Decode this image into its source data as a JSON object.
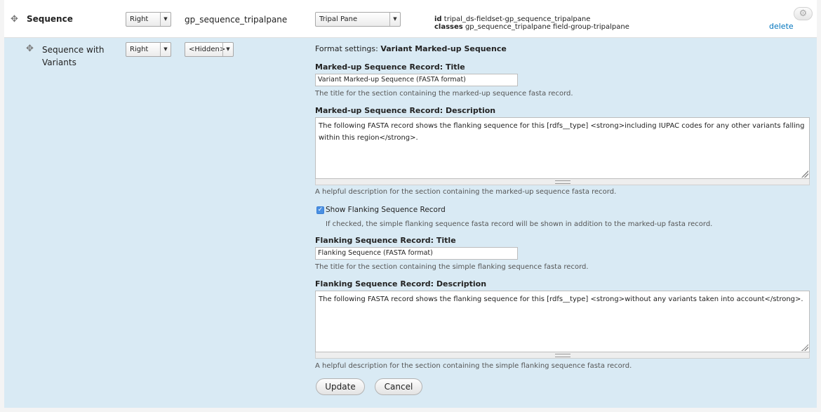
{
  "row_group": {
    "label": "Sequence",
    "region": "Right",
    "machine_name": "gp_sequence_tripalpane",
    "format": "Tripal Pane",
    "id_key": "id",
    "id_value": "tripal_ds-fieldset-gp_sequence_tripalpane",
    "classes_key": "classes",
    "classes_value": "gp_sequence_tripalpane field-group-tripalpane",
    "delete_label": "delete"
  },
  "row_field": {
    "label": "Sequence with Variants",
    "region": "Right",
    "label_display": "<Hidden>"
  },
  "format_settings": {
    "prefix": "Format settings:",
    "format_name": "Variant Marked-up Sequence",
    "markup_title_label": "Marked-up Sequence Record: Title",
    "markup_title_value": "Variant Marked-up Sequence (FASTA format)",
    "markup_title_help": "The title for the section containing the marked-up sequence fasta record.",
    "markup_desc_label": "Marked-up Sequence Record: Description",
    "markup_desc_value": "The following FASTA record shows the flanking sequence for this [rdfs__type] <strong>including IUPAC codes for any other variants falling within this region</strong>.",
    "markup_desc_help": "A helpful description for the section containing the marked-up sequence fasta record.",
    "show_flanking_label": "Show Flanking Sequence Record",
    "show_flanking_checked": true,
    "show_flanking_help": "If checked, the simple flanking sequence fasta record will be shown in addition to the marked-up fasta record.",
    "flank_title_label": "Flanking Sequence Record: Title",
    "flank_title_value": "Flanking Sequence (FASTA format)",
    "flank_title_help": "The title for the section containing the simple flanking sequence fasta record.",
    "flank_desc_label": "Flanking Sequence Record: Description",
    "flank_desc_value": "The following FASTA record shows the flanking sequence for this [rdfs__type] <strong>without any variants taken into account</strong>.",
    "flank_desc_help": "A helpful description for the section containing the simple flanking sequence fasta record.",
    "update_label": "Update",
    "cancel_label": "Cancel"
  },
  "icons": {
    "drag": "drag-handle-icon",
    "dropdown": "chevron-down-icon",
    "settings": "gear-icon",
    "check": "checkmark-icon"
  },
  "colors": {
    "edit_row_bg": "#d9eaf4",
    "link": "#0074bd",
    "checkbox": "#4a90e2"
  },
  "glyphs": {
    "drag": "✥",
    "arrow": "▼",
    "gear": "⚙",
    "check": "✓"
  }
}
